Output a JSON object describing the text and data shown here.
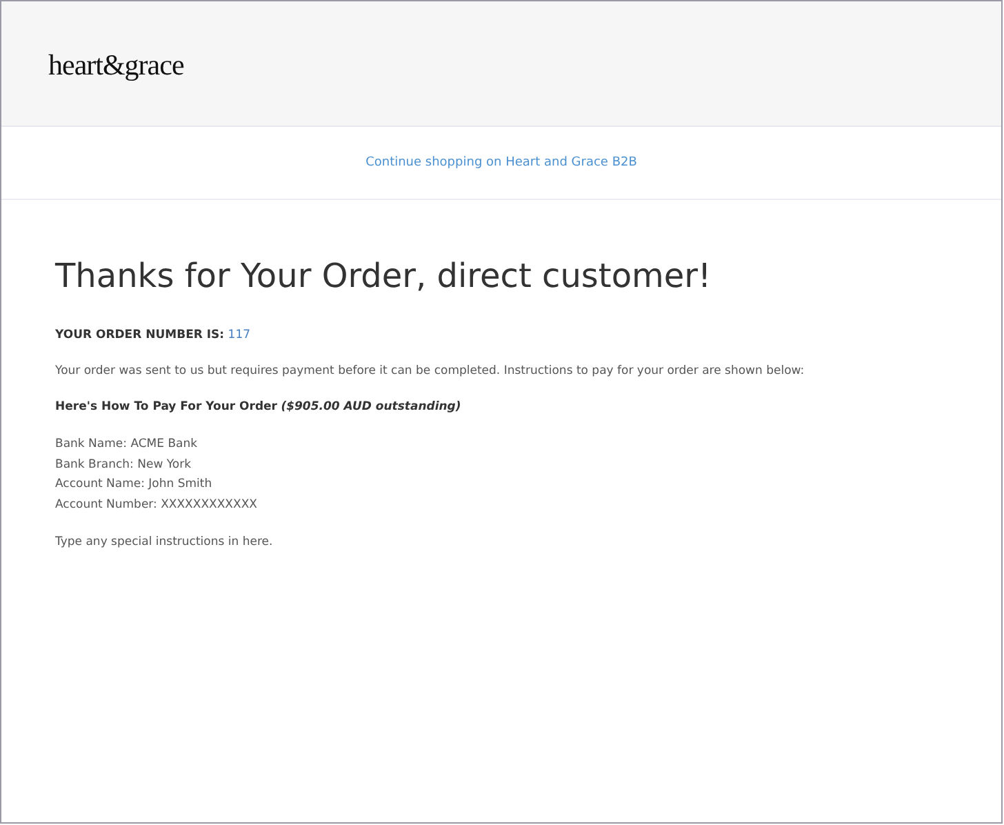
{
  "header": {
    "logo": "heart&grace"
  },
  "nav": {
    "link": "Continue shopping on Heart and Grace B2B"
  },
  "content": {
    "heading": "Thanks for Your Order, direct customer!",
    "order_number": {
      "label": "YOUR ORDER NUMBER IS:",
      "value": "117"
    },
    "message": "Your order was sent to us but requires payment before it can be completed. Instructions to pay for your order are shown below:",
    "payment_heading": {
      "title": "Here's How To Pay For Your Order",
      "amount": "($905.00 AUD outstanding)"
    },
    "bank_details": [
      "Bank Name: ACME Bank",
      "Bank Branch: New York",
      "Account Name: John Smith",
      "Account Number: XXXXXXXXXXXX"
    ],
    "instructions": "Type any special instructions in here."
  }
}
